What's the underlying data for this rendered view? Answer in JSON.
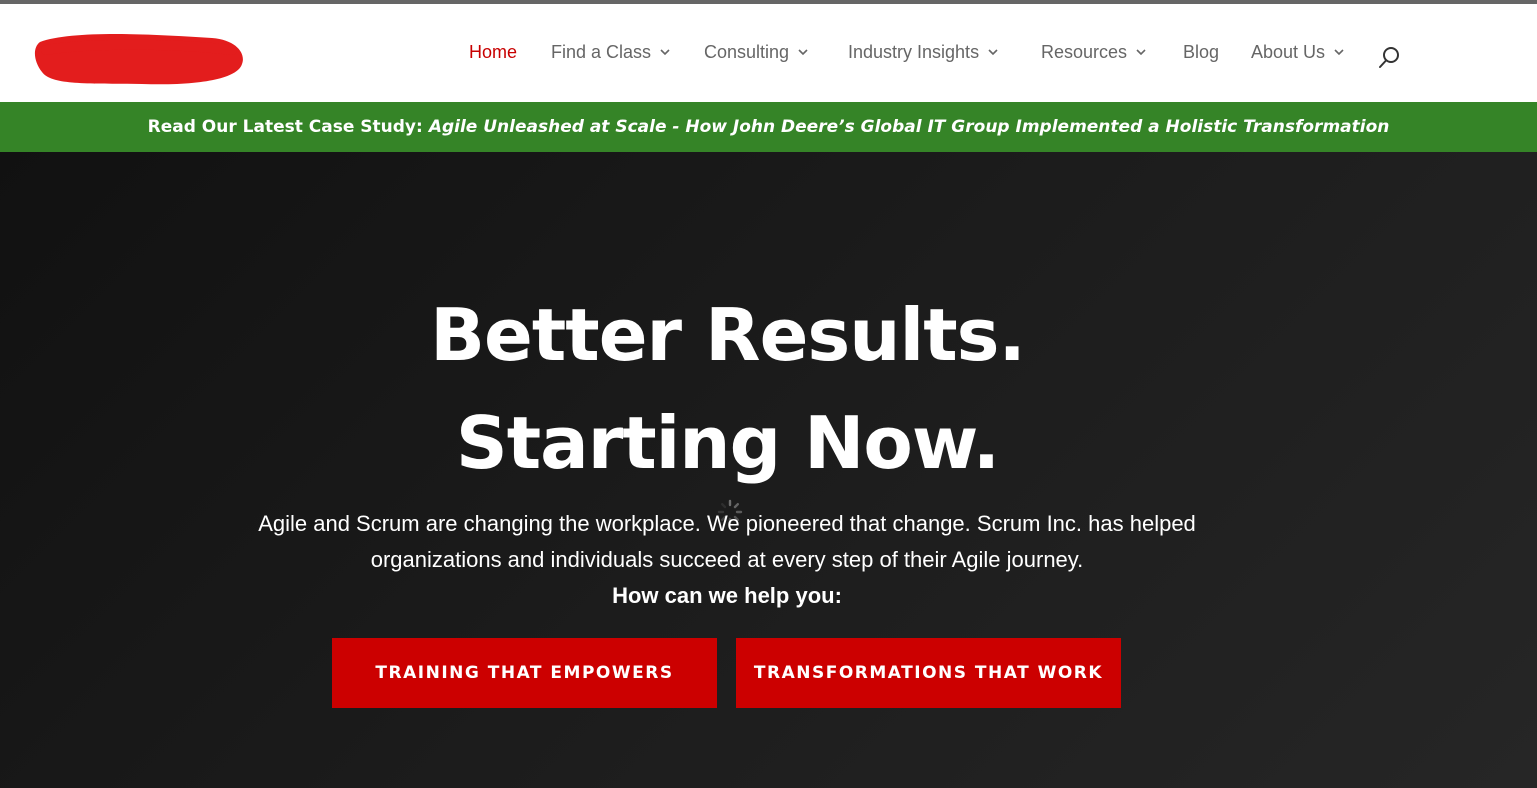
{
  "header": {
    "nav": [
      {
        "label": "Home",
        "active": true,
        "has_dropdown": false
      },
      {
        "label": "Find a Class",
        "active": false,
        "has_dropdown": true
      },
      {
        "label": "Consulting",
        "active": false,
        "has_dropdown": true
      },
      {
        "label": "Industry Insights",
        "active": false,
        "has_dropdown": true
      },
      {
        "label": "Resources",
        "active": false,
        "has_dropdown": true
      },
      {
        "label": "Blog",
        "active": false,
        "has_dropdown": false
      },
      {
        "label": "About Us",
        "active": false,
        "has_dropdown": true
      }
    ],
    "search_icon": "search-icon",
    "logo_icon": "redacted-logo"
  },
  "banner": {
    "lead": "Read Our Latest Case Study:",
    "link": "Agile Unleashed at Scale - How John Deere’s Global IT Group Implemented a Holistic Transformation"
  },
  "hero": {
    "title_line1": "Better Results.",
    "title_line2": "Starting Now.",
    "description": "Agile and Scrum are changing the workplace. We pioneered that change. Scrum Inc. has helped organizations and individuals succeed at every step of their Agile journey.",
    "question": "How can we help you:",
    "buttons": [
      {
        "label": "TRAINING THAT EMPOWERS"
      },
      {
        "label": "TRANSFORMATIONS THAT WORK"
      }
    ]
  },
  "colors": {
    "accent": "#c80000",
    "button_bg": "#cc0000",
    "banner_bg": "#358427",
    "nav_text": "#666666",
    "hero_bg": "#1b1b1b"
  }
}
